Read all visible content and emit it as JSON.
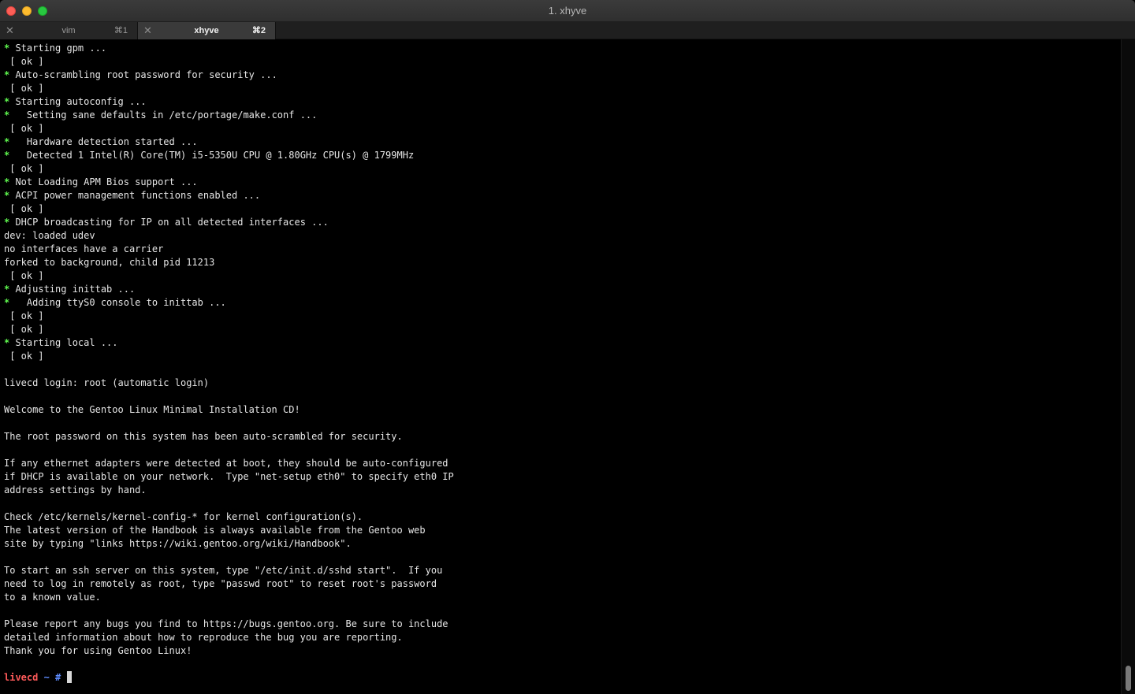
{
  "window": {
    "title": "1. xhyve"
  },
  "tabs": [
    {
      "close_icon": "✕",
      "label": "vim",
      "shortcut": "⌘1",
      "active": false
    },
    {
      "close_icon": "✕",
      "label": "xhyve",
      "shortcut": "⌘2",
      "active": true
    }
  ],
  "terminal": {
    "lines": [
      {
        "star": "*",
        "text": " Starting gpm ..."
      },
      {
        "text": " [ ok ]"
      },
      {
        "star": "*",
        "text": " Auto-scrambling root password for security ..."
      },
      {
        "text": " [ ok ]"
      },
      {
        "star": "*",
        "text": " Starting autoconfig ..."
      },
      {
        "star": "*",
        "text": "   Setting sane defaults in /etc/portage/make.conf ..."
      },
      {
        "text": " [ ok ]"
      },
      {
        "star": "*",
        "text": "   Hardware detection started ..."
      },
      {
        "star": "*",
        "text": "   Detected 1 Intel(R) Core(TM) i5-5350U CPU @ 1.80GHz CPU(s) @ 1799MHz"
      },
      {
        "text": " [ ok ]"
      },
      {
        "star": "*",
        "text": " Not Loading APM Bios support ..."
      },
      {
        "star": "*",
        "text": " ACPI power management functions enabled ..."
      },
      {
        "text": " [ ok ]"
      },
      {
        "star": "*",
        "text": " DHCP broadcasting for IP on all detected interfaces ..."
      },
      {
        "text": "dev: loaded udev"
      },
      {
        "text": "no interfaces have a carrier"
      },
      {
        "text": "forked to background, child pid 11213"
      },
      {
        "text": " [ ok ]"
      },
      {
        "star": "*",
        "text": " Adjusting inittab ..."
      },
      {
        "star": "*",
        "text": "   Adding ttyS0 console to inittab ..."
      },
      {
        "text": " [ ok ]"
      },
      {
        "text": " [ ok ]"
      },
      {
        "star": "*",
        "text": " Starting local ..."
      },
      {
        "text": " [ ok ]"
      },
      {
        "text": ""
      },
      {
        "text": "livecd login: root (automatic login)"
      },
      {
        "text": ""
      },
      {
        "text": "Welcome to the Gentoo Linux Minimal Installation CD!"
      },
      {
        "text": ""
      },
      {
        "text": "The root password on this system has been auto-scrambled for security."
      },
      {
        "text": ""
      },
      {
        "text": "If any ethernet adapters were detected at boot, they should be auto-configured"
      },
      {
        "text": "if DHCP is available on your network.  Type \"net-setup eth0\" to specify eth0 IP"
      },
      {
        "text": "address settings by hand."
      },
      {
        "text": ""
      },
      {
        "text": "Check /etc/kernels/kernel-config-* for kernel configuration(s)."
      },
      {
        "text": "The latest version of the Handbook is always available from the Gentoo web"
      },
      {
        "text": "site by typing \"links https://wiki.gentoo.org/wiki/Handbook\"."
      },
      {
        "text": ""
      },
      {
        "text": "To start an ssh server on this system, type \"/etc/init.d/sshd start\".  If you"
      },
      {
        "text": "need to log in remotely as root, type \"passwd root\" to reset root's password"
      },
      {
        "text": "to a known value."
      },
      {
        "text": ""
      },
      {
        "text": "Please report any bugs you find to https://bugs.gentoo.org. Be sure to include"
      },
      {
        "text": "detailed information about how to reproduce the bug you are reporting."
      },
      {
        "text": "Thank you for using Gentoo Linux!"
      },
      {
        "text": ""
      }
    ],
    "prompt": {
      "host": "livecd",
      "path": " ~ #",
      "input": " "
    }
  },
  "colors": {
    "star": "#5ff94f",
    "prompt_host": "#ff5a5a",
    "prompt_path": "#5e8cff",
    "background": "#000000",
    "foreground": "#e6e6e6"
  }
}
